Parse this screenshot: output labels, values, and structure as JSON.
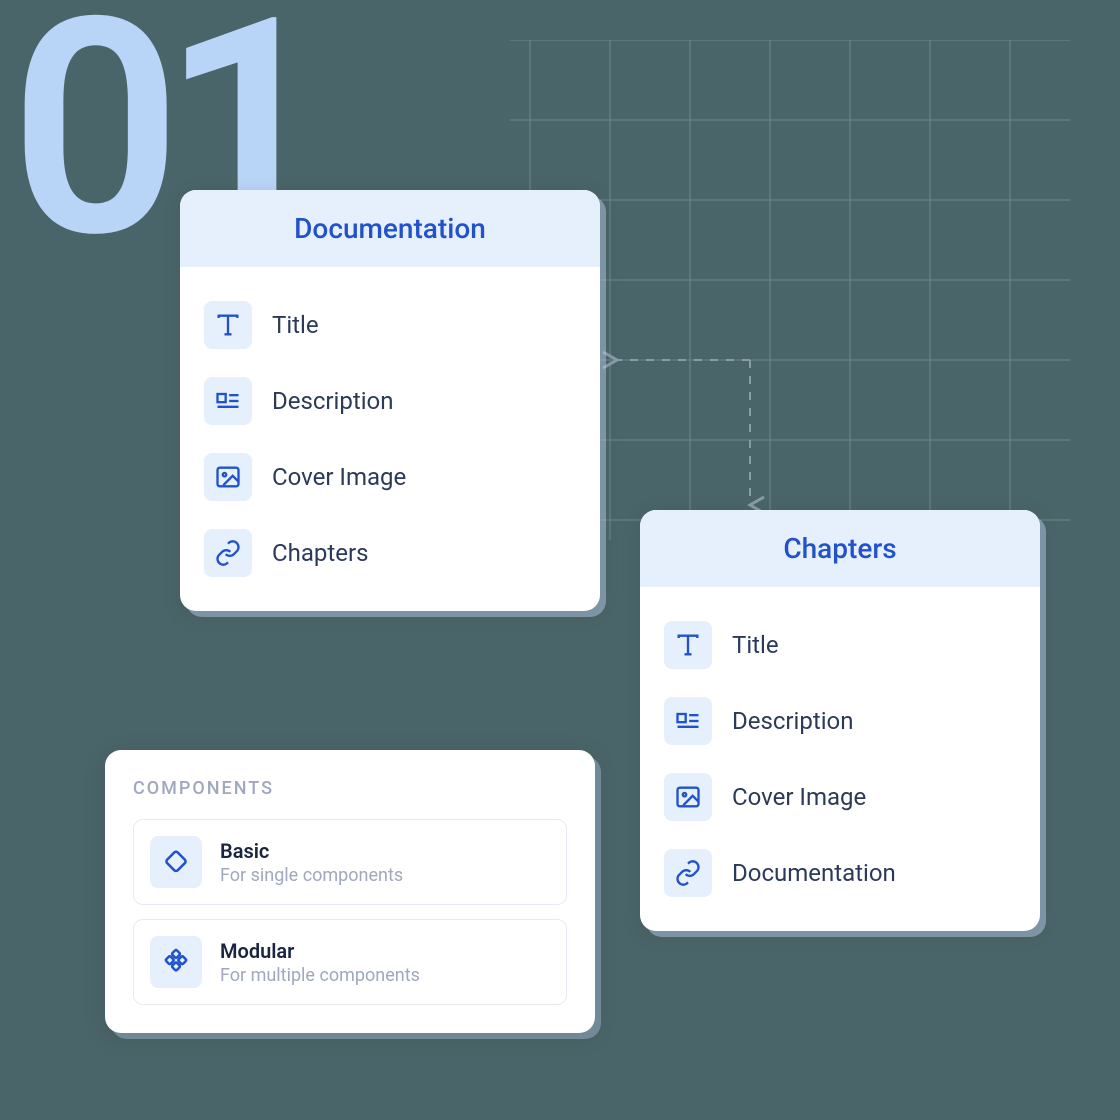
{
  "step_number": "01",
  "documentation_card": {
    "title": "Documentation",
    "fields": [
      {
        "icon": "type-icon",
        "label": "Title"
      },
      {
        "icon": "description-icon",
        "label": "Description"
      },
      {
        "icon": "image-icon",
        "label": "Cover Image"
      },
      {
        "icon": "link-icon",
        "label": "Chapters"
      }
    ]
  },
  "chapters_card": {
    "title": "Chapters",
    "fields": [
      {
        "icon": "type-icon",
        "label": "Title"
      },
      {
        "icon": "description-icon",
        "label": "Description"
      },
      {
        "icon": "image-icon",
        "label": "Cover Image"
      },
      {
        "icon": "link-icon",
        "label": "Documentation"
      }
    ]
  },
  "components_card": {
    "heading": "COMPONENTS",
    "items": [
      {
        "icon": "diamond-icon",
        "title": "Basic",
        "subtitle": "For single components"
      },
      {
        "icon": "modular-icon",
        "title": "Modular",
        "subtitle": "For multiple components"
      }
    ]
  },
  "colors": {
    "accent": "#2152cc",
    "icon_bg": "#e6f0fc",
    "text": "#2c3a5a",
    "muted": "#9fa8bd"
  }
}
